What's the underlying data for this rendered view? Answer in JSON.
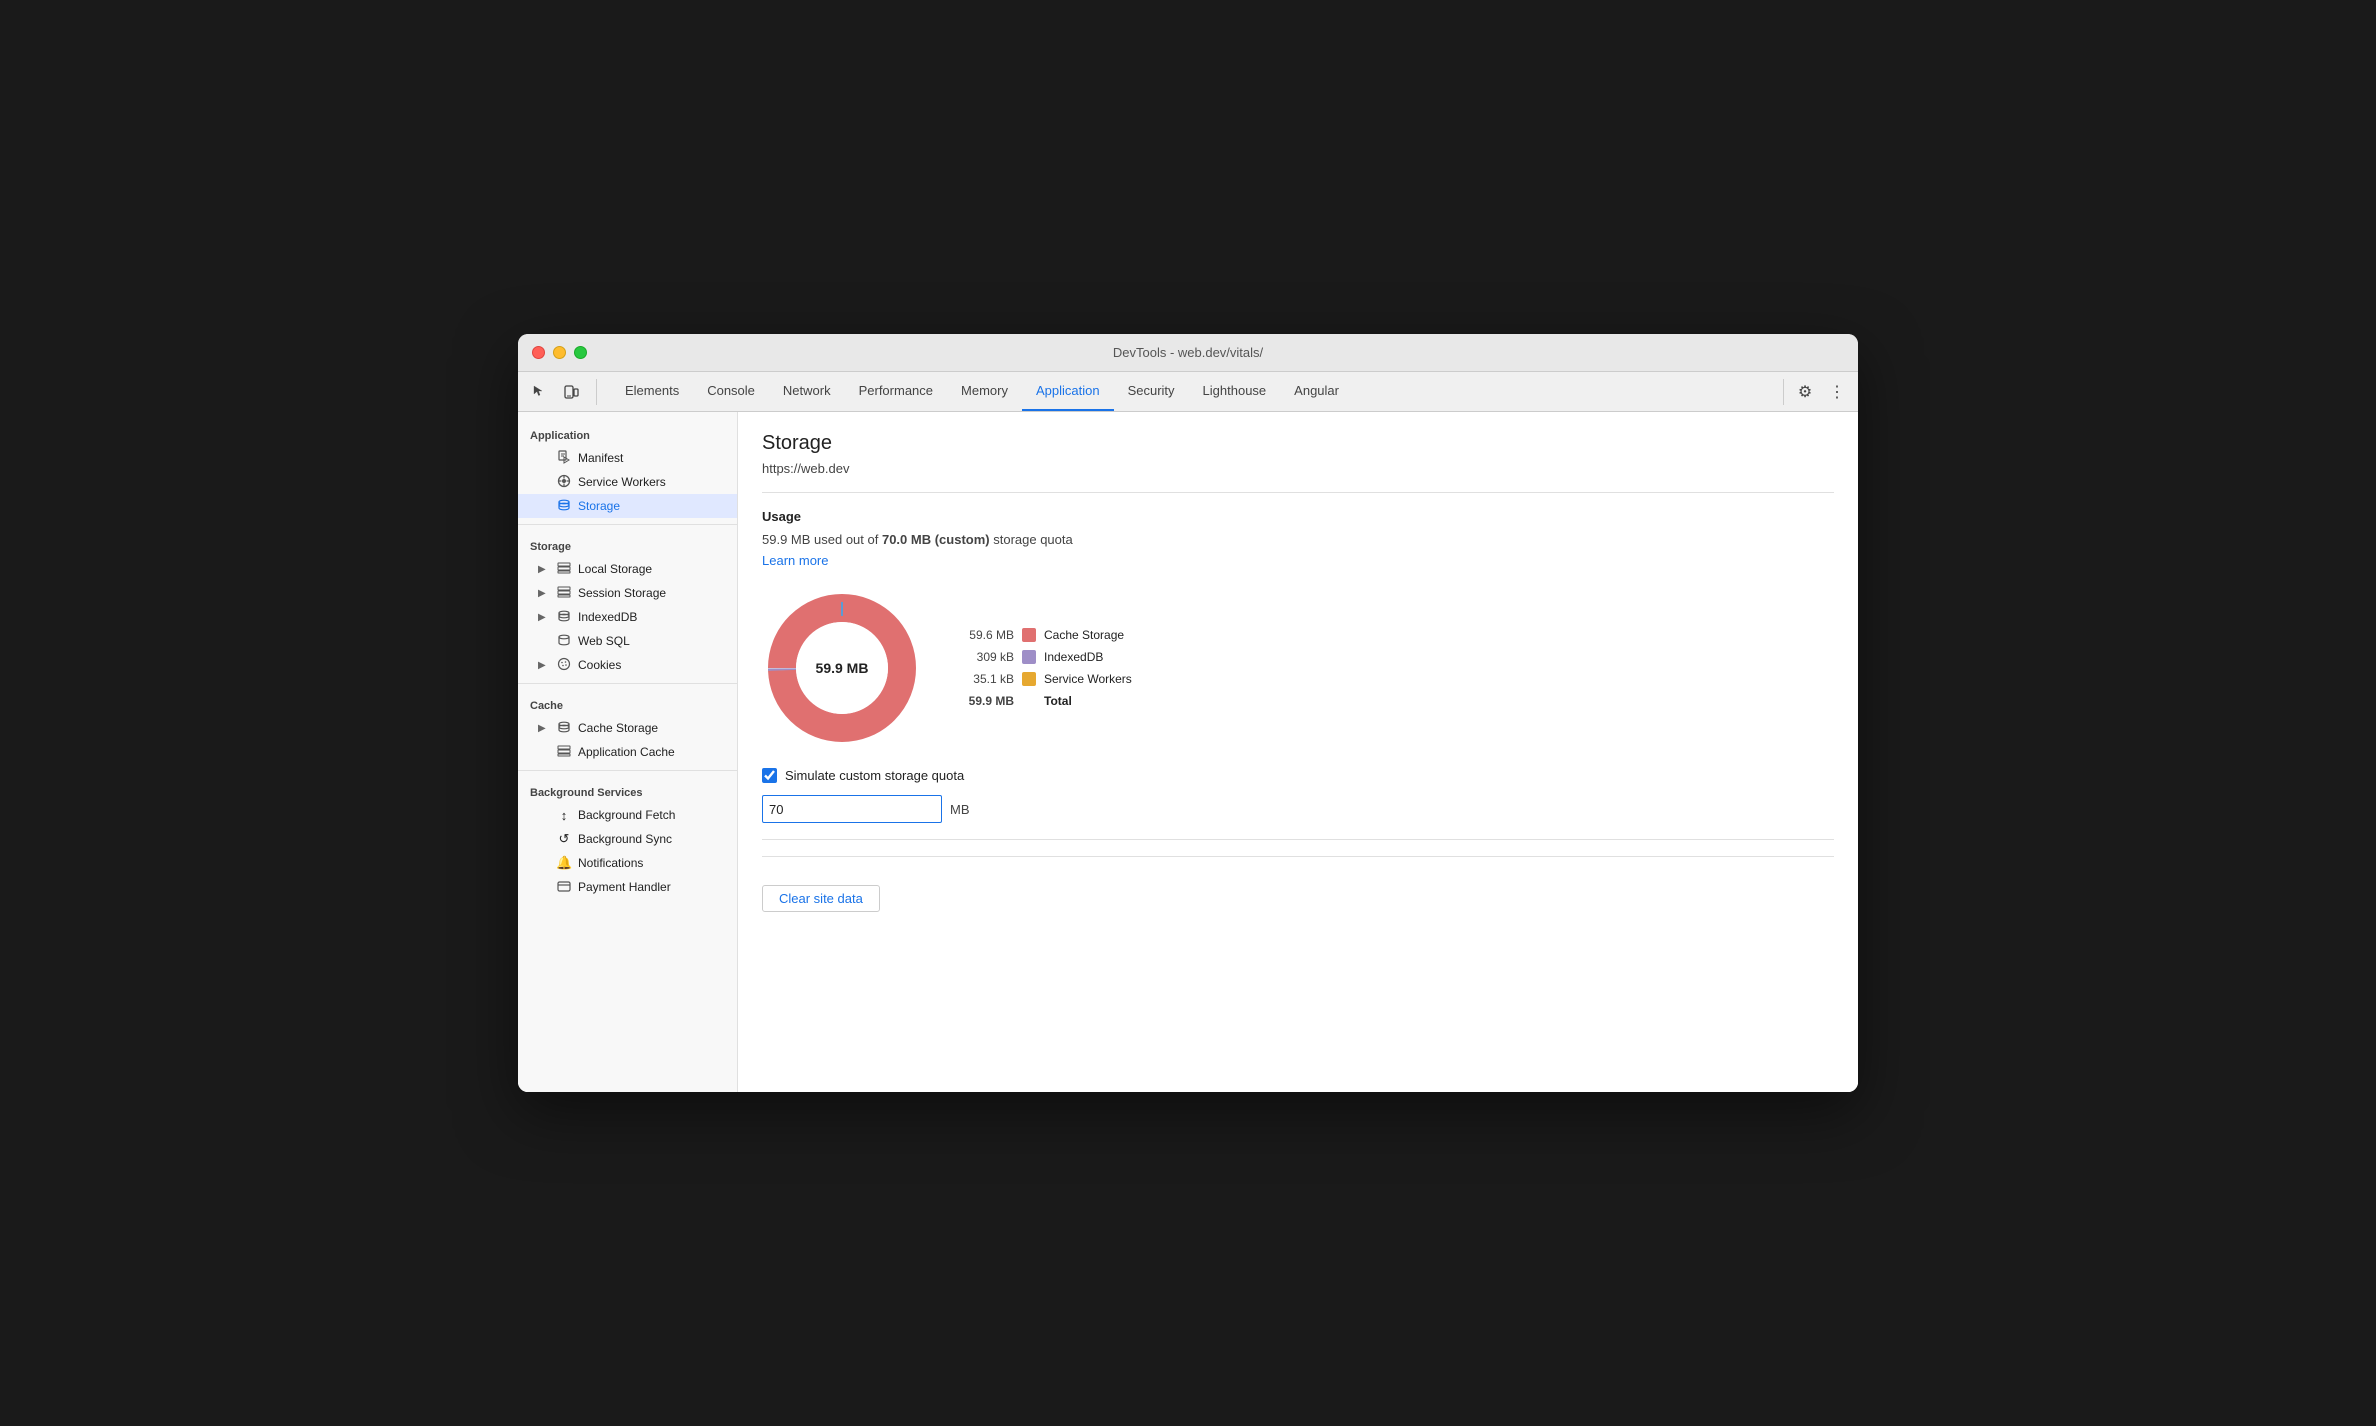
{
  "window": {
    "title": "DevTools - web.dev/vitals/"
  },
  "toolbar": {
    "inspect_icon": "⬚",
    "device_icon": "📱",
    "tabs": [
      {
        "label": "Elements",
        "active": false
      },
      {
        "label": "Console",
        "active": false
      },
      {
        "label": "Network",
        "active": false
      },
      {
        "label": "Performance",
        "active": false
      },
      {
        "label": "Memory",
        "active": false
      },
      {
        "label": "Application",
        "active": true
      },
      {
        "label": "Security",
        "active": false
      },
      {
        "label": "Lighthouse",
        "active": false
      },
      {
        "label": "Angular",
        "active": false
      }
    ],
    "settings_label": "⚙",
    "more_label": "⋮"
  },
  "sidebar": {
    "application_label": "Application",
    "items_application": [
      {
        "label": "Manifest",
        "icon": "📄",
        "expandable": false
      },
      {
        "label": "Service Workers",
        "icon": "⚙",
        "expandable": false
      },
      {
        "label": "Storage",
        "icon": "🗄",
        "expandable": false,
        "active": true
      }
    ],
    "storage_label": "Storage",
    "items_storage": [
      {
        "label": "Local Storage",
        "icon": "▦",
        "expandable": true
      },
      {
        "label": "Session Storage",
        "icon": "▦",
        "expandable": true
      },
      {
        "label": "IndexedDB",
        "icon": "🗄",
        "expandable": true
      },
      {
        "label": "Web SQL",
        "icon": "🗄",
        "expandable": false
      },
      {
        "label": "Cookies",
        "icon": "🍪",
        "expandable": true
      }
    ],
    "cache_label": "Cache",
    "items_cache": [
      {
        "label": "Cache Storage",
        "icon": "🗄",
        "expandable": true
      },
      {
        "label": "Application Cache",
        "icon": "▦",
        "expandable": false
      }
    ],
    "background_services_label": "Background Services",
    "items_background": [
      {
        "label": "Background Fetch",
        "icon": "↕"
      },
      {
        "label": "Background Sync",
        "icon": "↺"
      },
      {
        "label": "Notifications",
        "icon": "🔔"
      },
      {
        "label": "Payment Handler",
        "icon": "💳"
      }
    ]
  },
  "panel": {
    "title": "Storage",
    "url": "https://web.dev",
    "usage_section": "Usage",
    "usage_text_before": "59.9 MB used out of ",
    "usage_bold": "70.0 MB (custom)",
    "usage_text_after": " storage quota",
    "learn_more": "Learn more",
    "donut_label": "59.9 MB",
    "legend": [
      {
        "value": "59.6 MB",
        "label": "Cache Storage",
        "color": "#e07070"
      },
      {
        "value": "309 kB",
        "label": "IndexedDB",
        "color": "#9e8ec7"
      },
      {
        "value": "35.1 kB",
        "label": "Service Workers",
        "color": "#e6a830"
      },
      {
        "value": "59.9 MB",
        "label": "Total",
        "bold": true
      }
    ],
    "simulate_label": "Simulate custom storage quota",
    "quota_value": "70",
    "quota_unit": "MB",
    "clear_btn_label": "Clear site data"
  },
  "colors": {
    "cache_storage": "#e07070",
    "indexed_db": "#9e8ec7",
    "service_workers": "#e6a830",
    "active_tab_line": "#1a73e8",
    "link": "#1a73e8"
  }
}
